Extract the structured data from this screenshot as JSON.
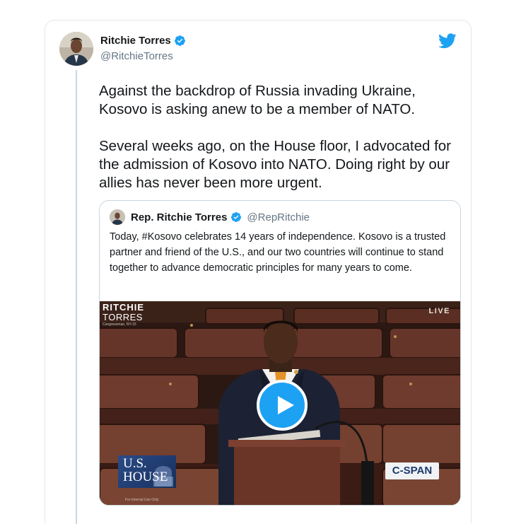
{
  "tweet": {
    "display_name": "Ritchie Torres",
    "handle": "@RitchieTorres",
    "verified_icon": "verified-badge-icon",
    "platform_icon": "twitter-bird-icon",
    "text": "Against the backdrop of Russia invading Ukraine, Kosovo is asking anew to be a member of NATO.\n\nSeveral weeks ago, on the House floor, I advocated for the admission of Kosovo into NATO. Doing right by our allies has never been more urgent."
  },
  "quoted_tweet": {
    "display_name": "Rep. Ritchie Torres",
    "handle": "@RepRitchie",
    "text": "Today, #Kosovo celebrates 14 years of independence. Kosovo is a trusted partner and friend of the U.S., and our two countries will continue to stand together to advance democratic principles for many years to come.",
    "video": {
      "lower_third_line1": "RITCHIE",
      "lower_third_line2": "TORRES",
      "lower_third_line3": "Congressman, NY-15",
      "live_label": "LIVE",
      "house_logo_line1": "U.S.",
      "house_logo_line2": "HOUSE",
      "network_logo": "C-SPAN",
      "footer_note": "For Internal Use Only",
      "play_icon": "play-icon"
    }
  },
  "colors": {
    "accent": "#1da1f2",
    "text_primary": "#14171a",
    "text_secondary": "#657786",
    "border": "#e1e8ed"
  }
}
